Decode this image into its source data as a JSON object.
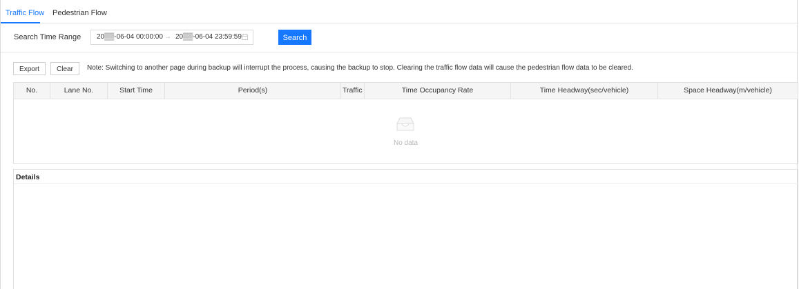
{
  "tabs": [
    {
      "label": "Traffic Flow",
      "active": true
    },
    {
      "label": "Pedestrian Flow",
      "active": false
    }
  ],
  "search": {
    "label": "Search Time Range",
    "start_value": "20▒▒-06-04 00:00:00",
    "range_separator": "→",
    "end_value": "20▒▒-06-04 23:59:59",
    "button_label": "Search"
  },
  "actions": {
    "export_label": "Export",
    "clear_label": "Clear",
    "note": "Note: Switching to another page during backup will interrupt the process, causing the backup to stop.  Clearing the traffic flow data will cause the pedestrian flow data to be cleared."
  },
  "table": {
    "columns": [
      "No.",
      "Lane No.",
      "Start Time",
      "Period(s)",
      "Traffic",
      "Time Occupancy Rate",
      "Time Headway(sec/vehicle)",
      "Space Headway(m/vehicle)"
    ],
    "rows": [],
    "empty_text": "No data"
  },
  "details": {
    "title": "Details"
  },
  "colors": {
    "accent": "#1677ff",
    "header_bg": "#f5f5f5",
    "border": "#e0e0e0",
    "empty_text": "#b8b8b8"
  },
  "icons": {
    "calendar": "calendar-icon",
    "empty": "empty-inbox-icon"
  }
}
